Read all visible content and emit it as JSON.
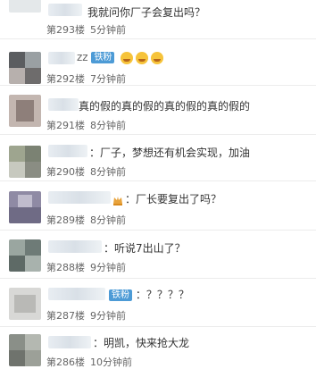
{
  "comments": [
    {
      "text": "我就问你厂子会复出吗？",
      "floor": "第293楼",
      "time": "5分钟前"
    },
    {
      "name_suffix": "zz",
      "badge": "铁粉",
      "emoji_icons": [
        "crying-face-icon",
        "crying-face-icon",
        "crying-face-icon"
      ],
      "floor": "第292楼",
      "time": "7分钟前"
    },
    {
      "text": "真的假的真的假的真的假的真的假的",
      "floor": "第291楼",
      "time": "8分钟前"
    },
    {
      "text": "：厂子，梦想还有机会实现，加油",
      "floor": "第290楼",
      "time": "8分钟前"
    },
    {
      "text": "：厂长要复出了吗？",
      "floor": "第289楼",
      "time": "8分钟前"
    },
    {
      "text": "：听说7出山了？",
      "floor": "第288楼",
      "time": "9分钟前"
    },
    {
      "badge": "铁粉",
      "text": "：？？？？",
      "floor": "第287楼",
      "time": "9分钟前"
    },
    {
      "text": "：明凯，快来抢大龙",
      "floor": "第286楼",
      "time": "10分钟前"
    }
  ]
}
